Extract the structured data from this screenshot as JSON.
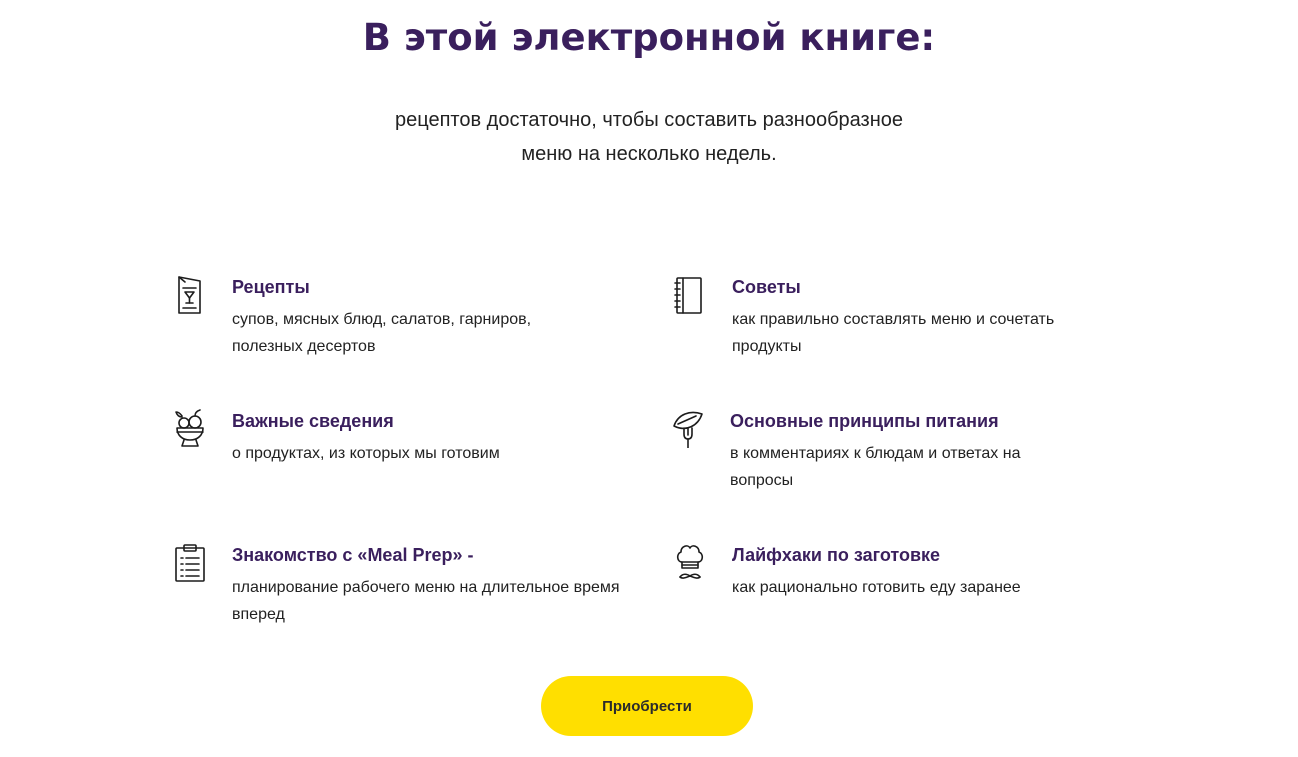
{
  "header": {
    "title": "В этой электронной книге:",
    "subtitle_line1": "рецептов достаточно, чтобы составить разнообразное",
    "subtitle_line2": "меню на несколько недель."
  },
  "features": [
    {
      "icon": "menu-card-icon",
      "title": "Рецепты",
      "description": "супов, мясных блюд, салатов, гарниров, полезных десертов"
    },
    {
      "icon": "notebook-icon",
      "title": "Советы",
      "description": "как правильно составлять меню и сочетать продукты"
    },
    {
      "icon": "fruit-bowl-icon",
      "title": "Важные сведения",
      "description": "о продуктах, из которых мы готовим"
    },
    {
      "icon": "leaf-fork-icon",
      "title": "Основные принципы питания",
      "description": "в комментариях к блюдам и ответах на вопросы"
    },
    {
      "icon": "clipboard-icon",
      "title": "Знакомство с «Meal Prep» -",
      "description": "планирование рабочего меню на длительное время вперед"
    },
    {
      "icon": "chef-hat-icon",
      "title": "Лайфхаки по заготовке",
      "description": "как рационально готовить еду заранее"
    }
  ],
  "cta": {
    "label": "Приобрести"
  },
  "colors": {
    "heading": "#3a1f5d",
    "button": "#ffdf00"
  }
}
